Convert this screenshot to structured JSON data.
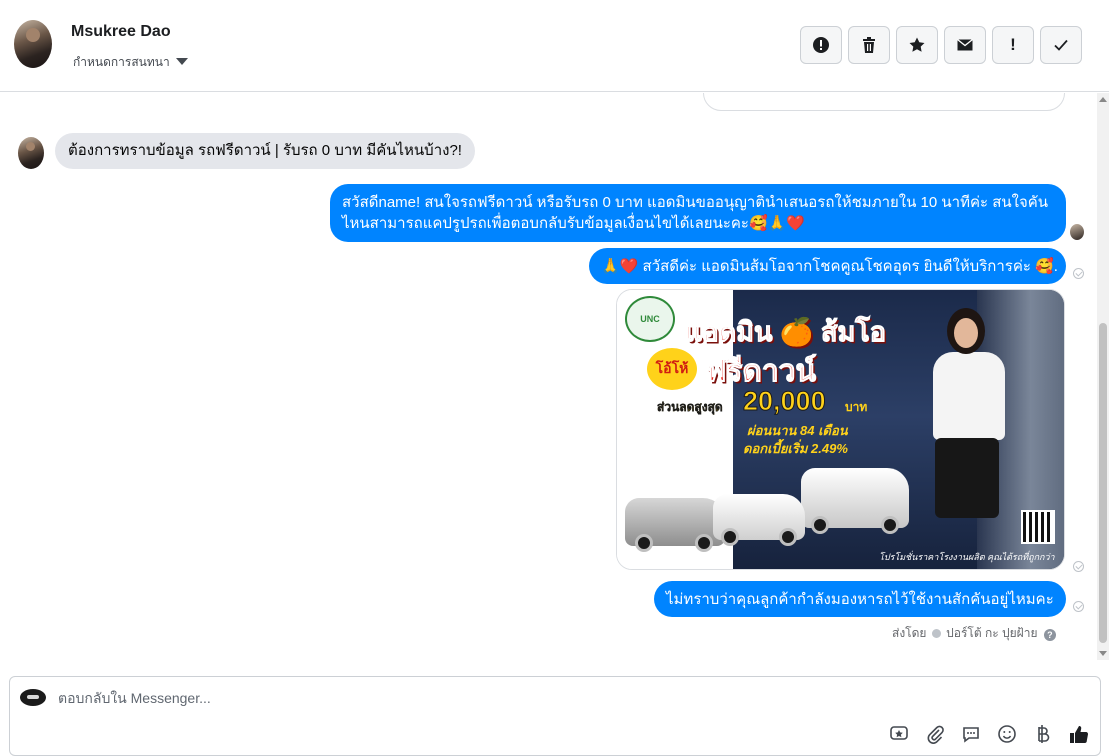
{
  "header": {
    "contact_name": "Msukree Dao",
    "assign_label": "กำหนดการสนทนา"
  },
  "toolbar": {
    "buttons": [
      {
        "icon": "alert-circle-icon",
        "label": ""
      },
      {
        "icon": "trash-icon",
        "label": ""
      },
      {
        "icon": "star-icon",
        "label": ""
      },
      {
        "icon": "envelope-icon",
        "label": ""
      },
      {
        "icon": "exclamation-icon",
        "label": "!"
      },
      {
        "icon": "check-icon",
        "label": ""
      }
    ]
  },
  "messages": {
    "incoming_1": "ต้องการทราบข้อมูล รถฟรีดาวน์ | รับรถ 0 บาท มีคันไหนบ้าง?!",
    "outgoing_1": "สวัสดีname! สนใจรถฟรีดาวน์ หรือรับรถ 0 บาท แอดมินขออนุญาตินำเสนอรถให้ชมภายใน 10 นาทีค่ะ สนใจคันไหนสามารถแคปรูปรถเพื่อตอบกลับรับข้อมูลเงื่อนไขได้เลยนะคะ🥰🙏❤️",
    "outgoing_2": "🙏❤️ สวัสดีค่ะ แอดมินส้มโอจากโชคคูณโชคอุดร ยินดีให้บริการค่ะ  🥰.",
    "outgoing_3": "ไม่ทราบว่าคุณลูกค้ากำลังมองหารถไว้ใช้งานสักคันอยู่ไหมคะ"
  },
  "promo": {
    "logo_text": "UNC",
    "title_line1": "แอดมิน 🍊 ส้มโอ",
    "badge": "โอ้โห้",
    "title_line2": "ฟรีดาวน์",
    "discount_label": "ส่วนลดสูงสุด",
    "discount_amount": "20,000",
    "discount_unit": "บาท",
    "installment": "ผ่อนนาน 84 เดือน",
    "interest": "ดอกเบี้ยเริ่ม 2.49%",
    "footer": "โปรโมชั่นราคาโรงงานผลิต คุณได้รถที่ถูกกว่า"
  },
  "sent_by": {
    "prefix": "ส่งโดย",
    "name": "ปอร์โต้ กะ ปุยฝ้าย"
  },
  "composer": {
    "placeholder": "ตอบกลับใน Messenger..."
  },
  "colors": {
    "outgoing_bubble": "#0084ff",
    "incoming_bubble": "#e4e6eb"
  }
}
